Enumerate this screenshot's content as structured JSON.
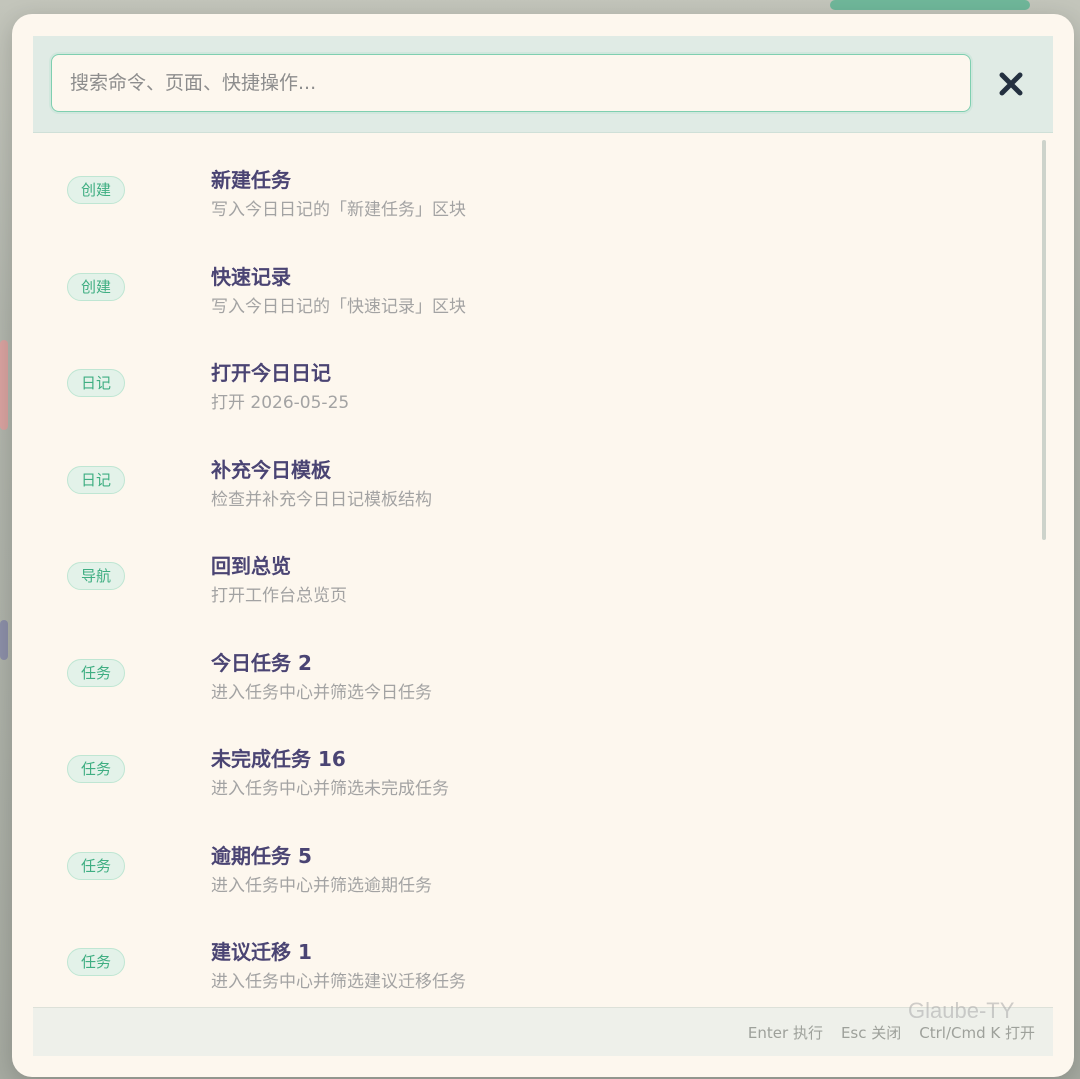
{
  "search": {
    "placeholder": "搜索命令、页面、快捷操作...",
    "value": ""
  },
  "close_icon": "close-icon",
  "items": [
    {
      "tag": "创建",
      "title": "新建任务",
      "desc": "写入今日日记的「新建任务」区块"
    },
    {
      "tag": "创建",
      "title": "快速记录",
      "desc": "写入今日日记的「快速记录」区块"
    },
    {
      "tag": "日记",
      "title": "打开今日日记",
      "desc": "打开 2026-05-25"
    },
    {
      "tag": "日记",
      "title": "补充今日模板",
      "desc": "检查并补充今日日记模板结构"
    },
    {
      "tag": "导航",
      "title": "回到总览",
      "desc": "打开工作台总览页"
    },
    {
      "tag": "任务",
      "title": "今日任务 2",
      "desc": "进入任务中心并筛选今日任务"
    },
    {
      "tag": "任务",
      "title": "未完成任务 16",
      "desc": "进入任务中心并筛选未完成任务"
    },
    {
      "tag": "任务",
      "title": "逾期任务 5",
      "desc": "进入任务中心并筛选逾期任务"
    },
    {
      "tag": "任务",
      "title": "建议迁移 1",
      "desc": "进入任务中心并筛选建议迁移任务"
    }
  ],
  "footer": {
    "hint_enter": "Enter 执行",
    "hint_esc": "Esc 关闭",
    "hint_open": "Ctrl/Cmd K 打开"
  },
  "watermark": "Glaube-TY",
  "colors": {
    "panel_bg": "#fdf7ee",
    "accent_green": "#3fae82",
    "title_purple": "#4a4473",
    "desc_gray": "#a3a3a3"
  }
}
